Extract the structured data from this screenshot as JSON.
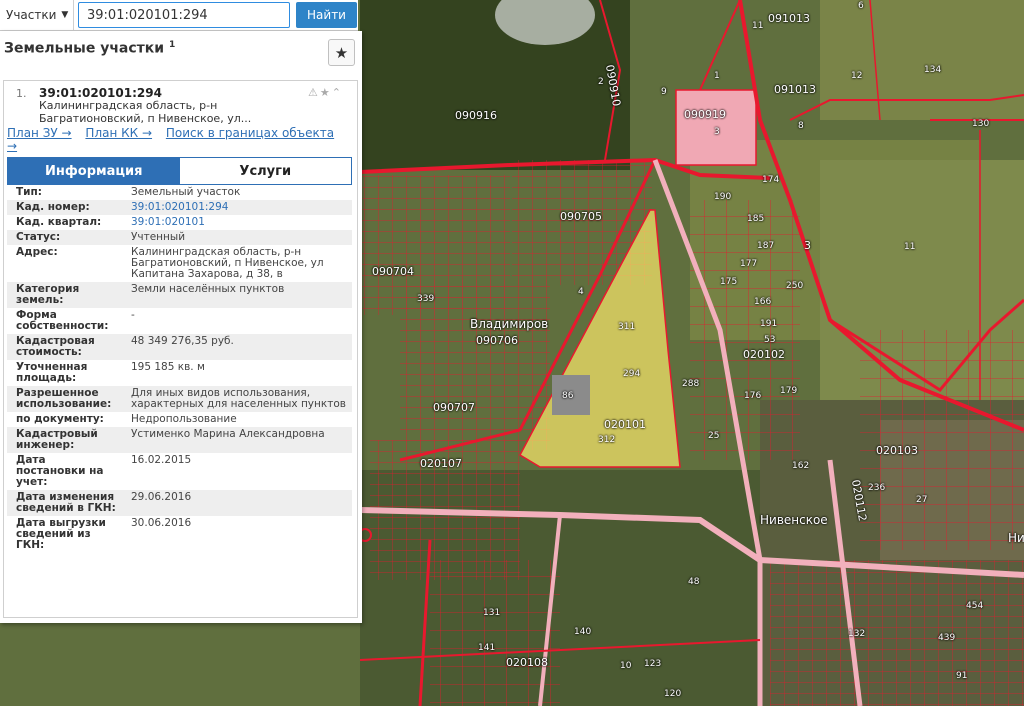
{
  "search": {
    "type_label": "Участки",
    "query": "39:01:020101:294",
    "button_label": "Найти"
  },
  "panel": {
    "title": "Земельные участки",
    "title_count": "1",
    "card": {
      "index": "1.",
      "number": "39:01:020101:294",
      "address_line1": "Калининградская область, р-н",
      "address_line2": "Багратионовский, п Нивенское, ул...",
      "tools": "⚠★⌃",
      "links": [
        "План ЗУ →",
        "План КК →",
        "Поиск в границах объекта →"
      ]
    },
    "tabs": {
      "info": "Информация",
      "services": "Услуги"
    },
    "rows": [
      {
        "k": "Тип:",
        "v": "Земельный участок"
      },
      {
        "k": "Кад. номер:",
        "v": "39:01:020101:294"
      },
      {
        "k": "Кад. квартал:",
        "v": "39:01:020101"
      },
      {
        "k": "Статус:",
        "v": "Учтенный"
      },
      {
        "k": "Адрес:",
        "v": "Калининградская область, р-н Багратионовский, п Нивенское, ул Капитана Захарова, д 38, в"
      },
      {
        "k": "Категория земель:",
        "v": "Земли населённых пунктов"
      },
      {
        "k": "Форма собственности:",
        "v": "-"
      },
      {
        "k": "Кадастровая стоимость:",
        "v": "48 349 276,35 руб."
      },
      {
        "k": "Уточненная площадь:",
        "v": "195 185 кв. м"
      },
      {
        "k": "Разрешенное использование:",
        "v": "Для иных видов использования, характерных для населенных пунктов"
      },
      {
        "k": "по документу:",
        "v": "Недропользование"
      },
      {
        "k": "Кадастровый инженер:",
        "v": "Устименко Марина Александровна"
      },
      {
        "k": "Дата постановки на учет:",
        "v": "16.02.2015"
      },
      {
        "k": "Дата изменения сведений в ГКН:",
        "v": "29.06.2016"
      },
      {
        "k": "Дата выгрузки сведений из ГКН:",
        "v": "30.06.2016"
      }
    ]
  },
  "map": {
    "places": [
      "Владимиров",
      "Нивенское",
      "Ни"
    ],
    "quarters": [
      "090916",
      "090919",
      "091013",
      "091013",
      "090705",
      "090704",
      "090706",
      "090707",
      "020107",
      "020101",
      "020102",
      "020103",
      "020108",
      "020112",
      "090910"
    ],
    "parcels": [
      "339",
      "311",
      "294",
      "86",
      "312",
      "1",
      "11",
      "3",
      "6",
      "8",
      "9",
      "2",
      "4",
      "12",
      "130",
      "134",
      "174",
      "190",
      "185",
      "187",
      "177",
      "175",
      "166",
      "191",
      "53",
      "250",
      "288",
      "25",
      "176",
      "179",
      "162",
      "236",
      "27",
      "48",
      "131",
      "141",
      "140",
      "10",
      "123",
      "120",
      "132",
      "439",
      "91",
      "454",
      "3",
      "11"
    ],
    "colors": {
      "boundary": "#e8182e",
      "highlight": "#f5e46a",
      "panel_accent": "#2e6fb5"
    }
  }
}
